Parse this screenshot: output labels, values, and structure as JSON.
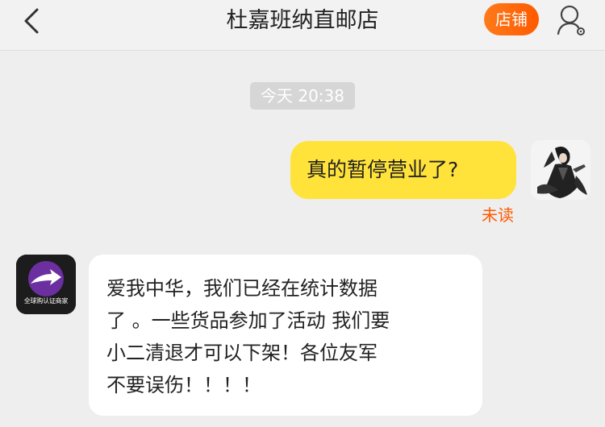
{
  "header": {
    "title": "杜嘉班纳直邮店",
    "shop_button": "店铺",
    "back_icon": "back-chevron-icon",
    "user_icon": "user-settings-icon"
  },
  "conversation": {
    "timestamp": "今天 20:38",
    "outgoing": {
      "text": "真的暂停营业了?",
      "status": "未读",
      "bubble_color": "#ffe33a"
    },
    "incoming": {
      "avatar_caption": "全球购认证商家",
      "lines": [
        "爱我中华，我们已经在统计数据",
        "了 。一些货品参加了活动 我们要",
        "小二清退才可以下架！各位友军",
        "不要误伤！！！！"
      ]
    }
  },
  "colors": {
    "accent": "#ff5a00",
    "background": "#eeeeee"
  }
}
